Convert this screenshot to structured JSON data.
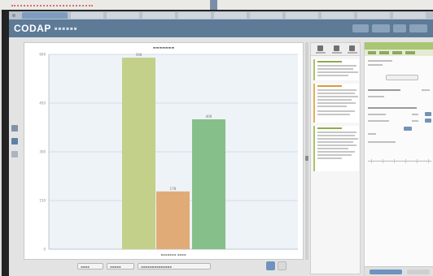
{
  "colors": {
    "header": "#5d7a97",
    "bar_green_light": "#c3d08a",
    "bar_orange": "#e1ab78",
    "bar_green": "#86bf8a",
    "right_panel_accent": "#a9c675"
  },
  "header": {
    "logo": "CODAP"
  },
  "chart_data": {
    "type": "bar",
    "categories": [
      "",
      "",
      ""
    ],
    "values": [
      590,
      178,
      400
    ],
    "ylim": [
      0,
      600
    ],
    "yticks": [
      0,
      150,
      300,
      450,
      600
    ],
    "bar_colors": [
      "#c3d08a",
      "#e1ab78",
      "#86bf8a"
    ],
    "grid": true,
    "legend": "none"
  },
  "icons": {
    "left_strip": [
      "graph-icon",
      "table-icon"
    ],
    "mid_toolbar": [
      "undo-icon",
      "redo-icon",
      "close-icon"
    ]
  }
}
